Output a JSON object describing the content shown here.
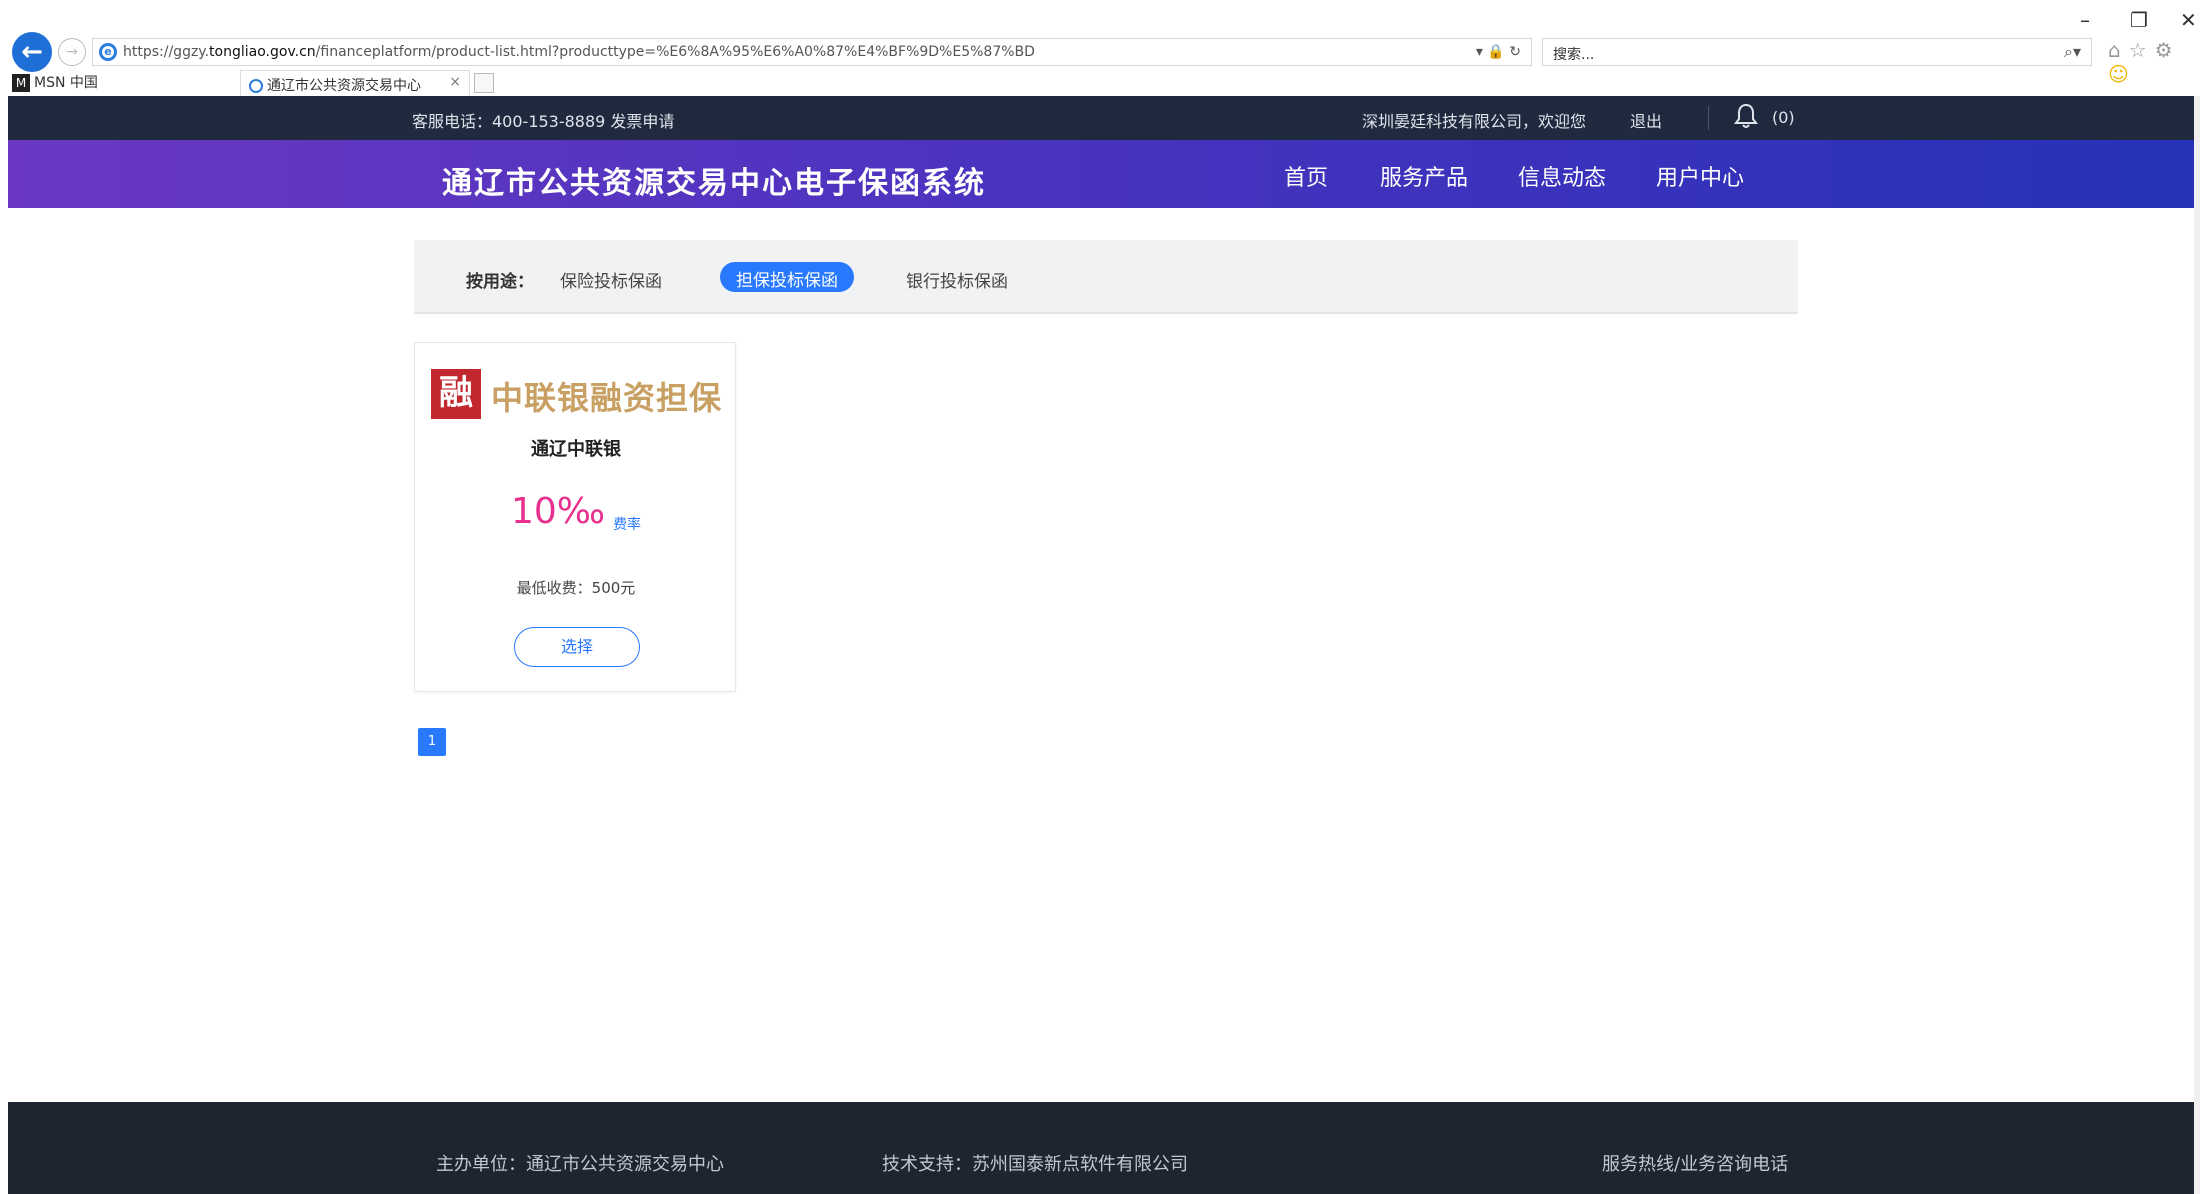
{
  "browser": {
    "url_prefix": "https://ggzy.",
    "url_host": "tongliao.gov.cn",
    "url_path": "/financeplatform/product-list.html?producttype=%E6%8A%95%E6%A0%87%E4%BF%9D%E5%87%BD",
    "search_placeholder": "搜索...",
    "favorite": "MSN 中国",
    "tab_title": "通辽市公共资源交易中心",
    "tab_close": "×",
    "window_minimize": "–",
    "window_restore": "❐",
    "window_close": "✕"
  },
  "topbar": {
    "hotline": "客服电话：400-153-8889 发票申请",
    "welcome": "深圳晏廷科技有限公司，欢迎您",
    "logout": "退出",
    "notification_count": "(0)"
  },
  "header": {
    "site_title": "通辽市公共资源交易中心电子保函系统",
    "nav": [
      "首页",
      "服务产品",
      "信息动态",
      "用户中心"
    ]
  },
  "filter": {
    "label": "按用途：",
    "options": [
      "保险投标保函",
      "担保投标保函",
      "银行投标保函"
    ],
    "active_index": 1
  },
  "product": {
    "logo_seal": "融",
    "logo_text": "中联银融资担保",
    "name": "通辽中联银",
    "rate": "10‰",
    "rate_label": "费率",
    "min_fee": "最低收费：500元",
    "select_label": "选择"
  },
  "pagination": {
    "current": "1"
  },
  "footer": {
    "sponsor": "主办单位：通辽市公共资源交易中心",
    "tech_support": "技术支持：苏州国泰新点软件有限公司",
    "hotline": "服务热线/业务咨询电话"
  },
  "colors": {
    "topbar_bg": "#1f2a3e",
    "header_gradient_start": "#6a38c2",
    "header_gradient_end": "#2632b8",
    "accent_blue": "#2979ff",
    "rate_pink": "#e8308e",
    "logo_gold": "#c9a063",
    "logo_red": "#c1272d",
    "footer_bg": "#1f2431"
  },
  "icons": [
    "back-arrow-icon",
    "forward-arrow-icon",
    "ie-logo-icon",
    "lock-icon",
    "refresh-icon",
    "search-icon",
    "home-icon",
    "star-icon",
    "gear-icon",
    "smiley-icon",
    "bell-icon"
  ]
}
